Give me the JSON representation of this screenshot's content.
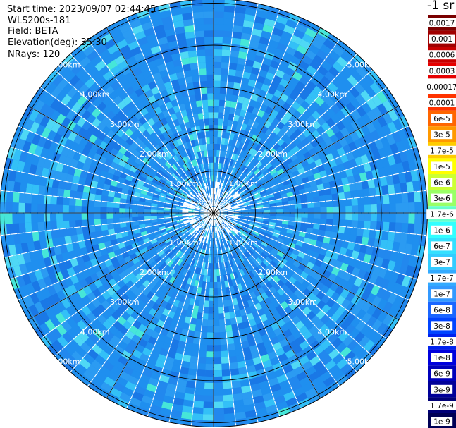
{
  "header": {
    "start_time": "Start time: 2023/09/07 02:44:45",
    "instrument": "WLS200s-181",
    "field": "Field: BETA",
    "elevation": "Elevation(deg): 35.30",
    "nrays": "NRays: 120"
  },
  "colorbar": {
    "title": "-1 sr",
    "labels": [
      "0.0017",
      "0.001",
      "0.0006",
      "0.0003",
      "0.00017",
      "0.0001",
      "6e-5",
      "3e-5",
      "1.7e-5",
      "1e-5",
      "6e-6",
      "3e-6",
      "1.7e-6",
      "1e-6",
      "6e-7",
      "3e-7",
      "1.7e-7",
      "1e-7",
      "6e-8",
      "3e-8",
      "1.7e-8",
      "1e-8",
      "6e-9",
      "3e-9",
      "1.7e-9",
      "1e-9"
    ],
    "colors": [
      "#7a0000",
      "#a00000",
      "#c80000",
      "#e60000",
      "#ffffff",
      "#ff3300",
      "#ff6600",
      "#ff9900",
      "#ffcc00",
      "#ffff00",
      "#ccff33",
      "#99ff66",
      "#66ffcc",
      "#33ffff",
      "#33e0ff",
      "#33ccff",
      "#33aaff",
      "#3399ff",
      "#1a66ff",
      "#0044ff",
      "#0022ee",
      "#0000dd",
      "#0000bb",
      "#000099",
      "#000077",
      "#000055"
    ]
  },
  "chart_data": {
    "type": "heatmap",
    "projection": "polar (PPI scan)",
    "field": "BETA",
    "nrays": 120,
    "range_rings_km": [
      1,
      2,
      3,
      4,
      5
    ],
    "ring_labels": [
      "1.00km",
      "2.00km",
      "3.00km",
      "4.00km",
      "5.00km"
    ],
    "max_range_km": 5.1,
    "spoke_angles_deg": [
      0,
      30,
      60,
      90,
      120,
      150,
      180,
      210,
      240,
      270,
      300,
      330
    ],
    "colors": [
      "#1f8fef",
      "#2b9bf2",
      "#1a78e6",
      "#33c0f7",
      "#4fd8f5",
      "#46e6d8",
      "#2288ee"
    ]
  }
}
